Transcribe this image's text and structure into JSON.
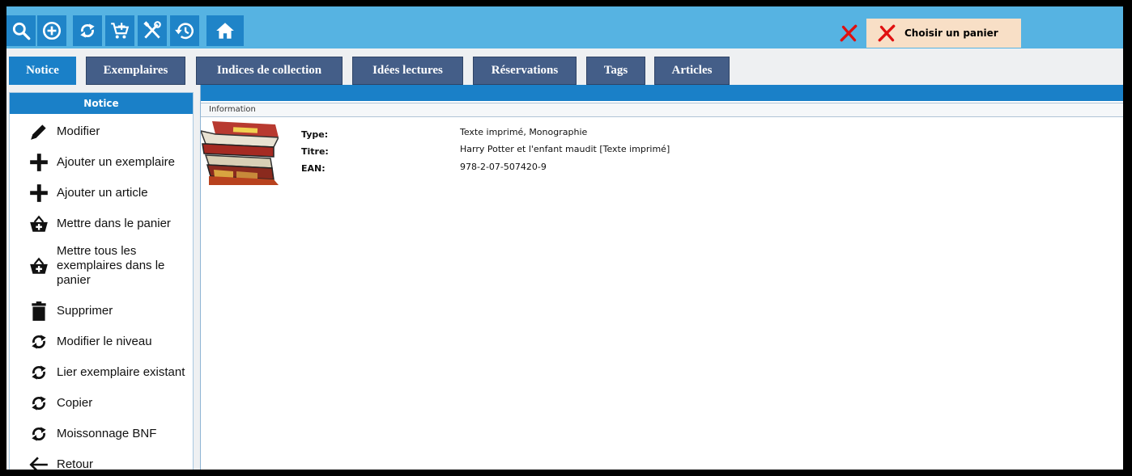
{
  "toolbar": {
    "buttons": [
      {
        "icon": "search-icon"
      },
      {
        "icon": "add-circle-icon"
      },
      {
        "icon": "refresh-icon"
      },
      {
        "icon": "cart-add-icon"
      },
      {
        "icon": "tools-icon"
      },
      {
        "icon": "history-icon"
      },
      {
        "icon": "home-icon"
      }
    ],
    "basket_label": "Choisir un panier",
    "accent": "#56b3e2",
    "button_color": "#1f84c8"
  },
  "tabs": [
    {
      "label": "Notice",
      "active": true
    },
    {
      "label": "Exemplaires"
    },
    {
      "label": "Indices de collection"
    },
    {
      "label": "Idées lectures"
    },
    {
      "label": "Réservations"
    },
    {
      "label": "Tags"
    },
    {
      "label": "Articles"
    }
  ],
  "sidebar": {
    "title": "Notice",
    "items": [
      {
        "label": "Modifier",
        "icon": "pencil-icon"
      },
      {
        "label": "Ajouter un exemplaire",
        "icon": "plus-icon"
      },
      {
        "label": "Ajouter un article",
        "icon": "plus-icon"
      },
      {
        "label": "Mettre dans le panier",
        "icon": "basket-add-icon"
      },
      {
        "label": "Mettre tous les exemplaires dans le panier",
        "icon": "basket-add-icon"
      },
      {
        "label": "Supprimer",
        "icon": "trash-icon"
      },
      {
        "label": "Modifier le niveau",
        "icon": "refresh-icon"
      },
      {
        "label": "Lier exemplaire existant",
        "icon": "refresh-icon"
      },
      {
        "label": "Copier",
        "icon": "refresh-icon"
      },
      {
        "label": "Moissonnage BNF",
        "icon": "refresh-icon"
      },
      {
        "label": "Retour",
        "icon": "arrow-left-icon"
      }
    ]
  },
  "main": {
    "section_title": "Information",
    "fields": [
      {
        "label": "Type:",
        "value": "Texte imprimé, Monographie"
      },
      {
        "label": "Titre:",
        "value": "Harry Potter et l'enfant maudit [Texte imprimé]"
      },
      {
        "label": "EAN:",
        "value": "978-2-07-507420-9"
      }
    ]
  }
}
